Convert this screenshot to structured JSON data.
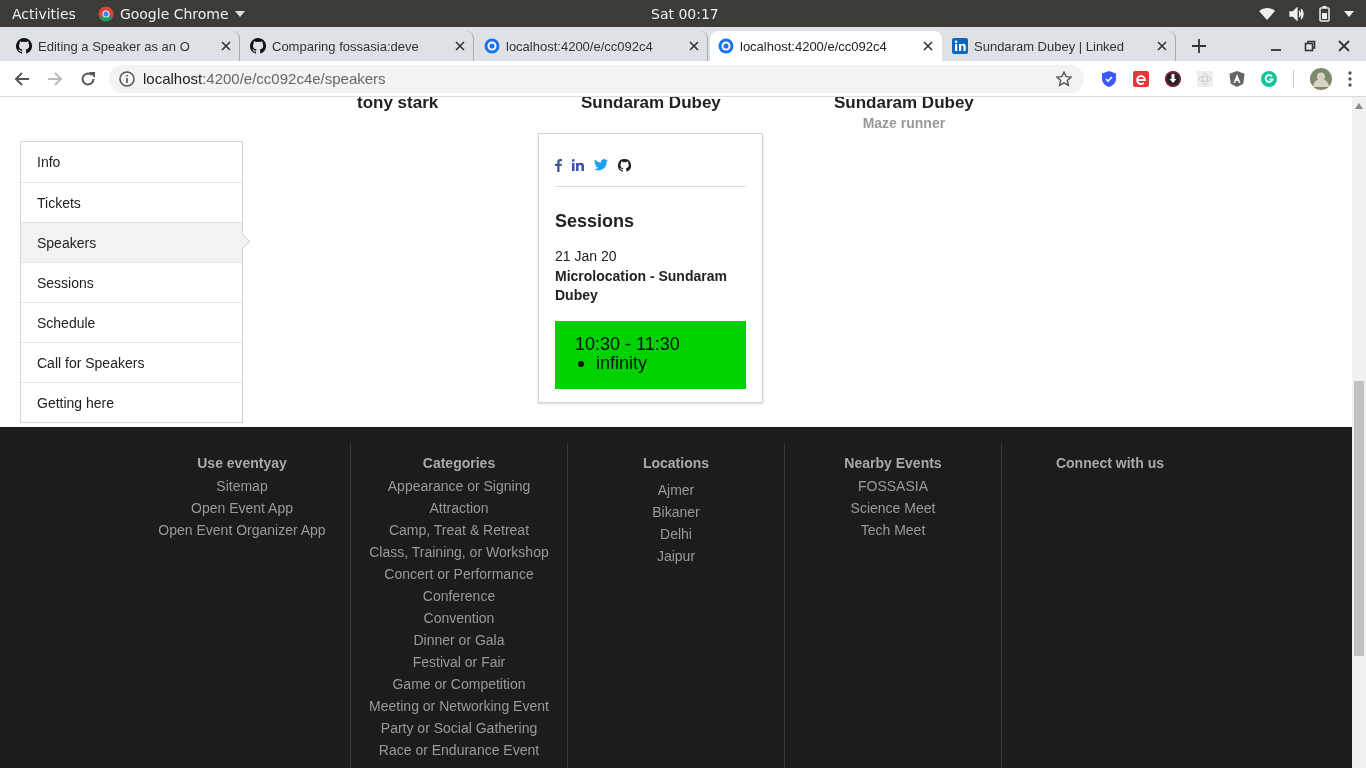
{
  "system_bar": {
    "activities": "Activities",
    "app": "Google Chrome",
    "clock": "Sat 00:17"
  },
  "tabs": [
    {
      "title": "Editing a Speaker as an O",
      "selected": false
    },
    {
      "title": "Comparing fossasia:deve",
      "selected": false
    },
    {
      "title": "localhost:4200/e/cc092c4",
      "selected": false
    },
    {
      "title": "localhost:4200/e/cc092c4",
      "selected": true
    },
    {
      "title": "Sundaram Dubey | Linked",
      "selected": false
    }
  ],
  "address_bar": {
    "host": "localhost",
    "path": ":4200/e/cc092c4e/speakers"
  },
  "speakers": [
    {
      "name": "tony stark"
    },
    {
      "name": "Sundaram Dubey"
    },
    {
      "name": "Sundaram Dubey",
      "subtitle": "Maze runner"
    }
  ],
  "sidebar": [
    {
      "label": "Info",
      "selected": false
    },
    {
      "label": "Tickets",
      "selected": false
    },
    {
      "label": "Speakers",
      "selected": true
    },
    {
      "label": "Sessions",
      "selected": false
    },
    {
      "label": "Schedule",
      "selected": false
    },
    {
      "label": "Call for Speakers",
      "selected": false
    },
    {
      "label": "Getting here",
      "selected": false
    }
  ],
  "speaker_card": {
    "heading": "Sessions",
    "date": "21 Jan 20",
    "title": "Microlocation - Sundaram Dubey",
    "time": "10:30 - 11:30",
    "track": "infinity"
  },
  "footer": [
    {
      "heading": "Use eventyay",
      "links": [
        "Sitemap",
        "Open Event App",
        "Open Event Organizer App"
      ]
    },
    {
      "heading": "Categories",
      "links": [
        "Appearance or Signing",
        "Attraction",
        "Camp, Treat & Retreat",
        "Class, Training, or Workshop",
        "Concert or Performance",
        "Conference",
        "Convention",
        "Dinner or Gala",
        "Festival or Fair",
        "Game or Competition",
        "Meeting or Networking Event",
        "Party or Social Gathering",
        "Race or Endurance Event"
      ]
    },
    {
      "heading": "Locations",
      "links": [
        "Ajmer",
        "Bikaner",
        "Delhi",
        "Jaipur"
      ]
    },
    {
      "heading": "Nearby Events",
      "links": [
        "FOSSASIA",
        "Science Meet",
        "Tech Meet"
      ]
    },
    {
      "heading": "Connect with us"
    }
  ]
}
